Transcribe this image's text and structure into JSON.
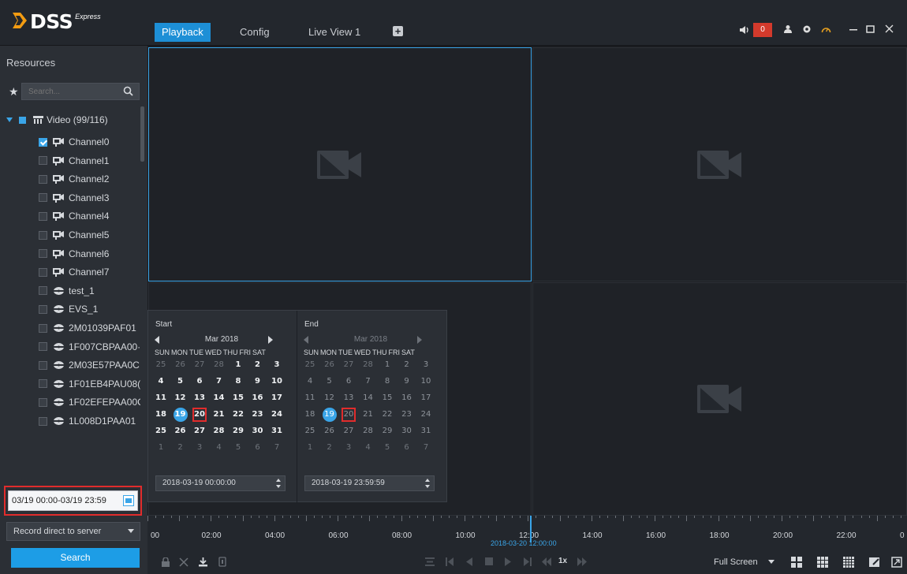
{
  "app": {
    "logo": "DSS",
    "logo_sub": "Express"
  },
  "tabs": [
    {
      "label": "Playback",
      "active": true
    },
    {
      "label": "Config",
      "active": false
    },
    {
      "label": "Live View 1",
      "active": false
    }
  ],
  "header": {
    "alarm_count": "0"
  },
  "sidebar": {
    "title": "Resources",
    "search_placeholder": "Search...",
    "root": {
      "label": "Video (99/116)"
    },
    "channels": [
      {
        "label": "Channel0",
        "checked": true,
        "type": "camera"
      },
      {
        "label": "Channel1",
        "checked": false,
        "type": "camera"
      },
      {
        "label": "Channel2",
        "checked": false,
        "type": "camera"
      },
      {
        "label": "Channel3",
        "checked": false,
        "type": "camera"
      },
      {
        "label": "Channel4",
        "checked": false,
        "type": "camera"
      },
      {
        "label": "Channel5",
        "checked": false,
        "type": "camera"
      },
      {
        "label": "Channel6",
        "checked": false,
        "type": "camera"
      },
      {
        "label": "Channel7",
        "checked": false,
        "type": "camera"
      },
      {
        "label": "test_1",
        "checked": false,
        "type": "device"
      },
      {
        "label": "EVS_1",
        "checked": false,
        "type": "device"
      },
      {
        "label": "2M01039PAF01",
        "checked": false,
        "type": "device"
      },
      {
        "label": "1F007CBPAA00·",
        "checked": false,
        "type": "device"
      },
      {
        "label": "2M03E57PAA0C",
        "checked": false,
        "type": "device"
      },
      {
        "label": "1F01EB4PAU08(",
        "checked": false,
        "type": "device"
      },
      {
        "label": "1F02EFEPAA00C",
        "checked": false,
        "type": "device"
      },
      {
        "label": "1L008D1PAA01",
        "checked": false,
        "type": "device"
      }
    ],
    "time_range": "03/19 00:00-03/19 23:59",
    "record_source": "Record direct to server",
    "search_button": "Search"
  },
  "calendar": {
    "start": {
      "label": "Start",
      "month": "Mar 2018",
      "datetime": "2018-03-19 00:00:00"
    },
    "end": {
      "label": "End",
      "month": "Mar 2018",
      "datetime": "2018-03-19 23:59:59"
    },
    "weekdays": [
      "SUN",
      "MON",
      "TUE",
      "WED",
      "THU",
      "FRI",
      "SAT"
    ],
    "weeks": [
      [
        "25",
        "26",
        "27",
        "28",
        "1",
        "2",
        "3"
      ],
      [
        "4",
        "5",
        "6",
        "7",
        "8",
        "9",
        "10"
      ],
      [
        "11",
        "12",
        "13",
        "14",
        "15",
        "16",
        "17"
      ],
      [
        "18",
        "19",
        "20",
        "21",
        "22",
        "23",
        "24"
      ],
      [
        "25",
        "26",
        "27",
        "28",
        "29",
        "30",
        "31"
      ],
      [
        "1",
        "2",
        "3",
        "4",
        "5",
        "6",
        "7"
      ]
    ],
    "today": "19",
    "marked": "20"
  },
  "timeline": {
    "labels": [
      "00",
      "02:00",
      "04:00",
      "06:00",
      "08:00",
      "10:00",
      "12:00",
      "14:00",
      "16:00",
      "18:00",
      "20:00",
      "22:00",
      "0"
    ],
    "cursor_time": "2018-03-20 12:00:00"
  },
  "bottom": {
    "speed": "1x",
    "fullscreen": "Full Screen"
  }
}
